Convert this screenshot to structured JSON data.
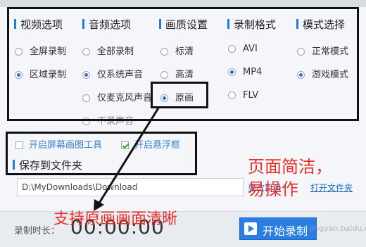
{
  "columns": [
    {
      "heading": "视频选项",
      "options": [
        {
          "label": "全屏录制",
          "selected": false
        },
        {
          "label": "区域录制",
          "selected": true
        }
      ]
    },
    {
      "heading": "音频选项",
      "options": [
        {
          "label": "全部录制",
          "selected": false
        },
        {
          "label": "仅系统声音",
          "selected": true
        },
        {
          "label": "仅麦克风声音",
          "selected": false
        },
        {
          "label": "不录声音",
          "selected": false
        }
      ]
    },
    {
      "heading": "画质设置",
      "options": [
        {
          "label": "标清",
          "selected": false
        },
        {
          "label": "高清",
          "selected": false
        },
        {
          "label": "原画",
          "selected": true
        }
      ]
    },
    {
      "heading": "录制格式",
      "options": [
        {
          "label": "AVI",
          "selected": false
        },
        {
          "label": "MP4",
          "selected": true
        },
        {
          "label": "FLV",
          "selected": false
        }
      ]
    },
    {
      "heading": "模式选择",
      "options": [
        {
          "label": "正常模式",
          "selected": false
        },
        {
          "label": "游戏模式",
          "selected": true
        }
      ]
    }
  ],
  "extras": {
    "screen_draw_tool": {
      "label": "开启屏幕画图工具",
      "checked": false
    },
    "floating_window": {
      "label": "开启悬浮框",
      "checked": true
    }
  },
  "save": {
    "heading": "保存到文件夹",
    "path": "D:\\MyDownloads\\Download",
    "change_dir": "更改目录",
    "open_folder": "打开文件夹"
  },
  "bottom": {
    "time_label": "录制时长：",
    "time_value": "00:00:00",
    "start_button": "开始录制"
  },
  "annotations": {
    "simple_line1": "页面简洁，",
    "simple_line2": "易操作",
    "clarity": "支持原画画面清晰"
  },
  "watermark": "jingyan.baidu.com",
  "colors": {
    "accent": "#2a7de1",
    "annotation": "#e8302a",
    "highlight_box": "#111111"
  }
}
